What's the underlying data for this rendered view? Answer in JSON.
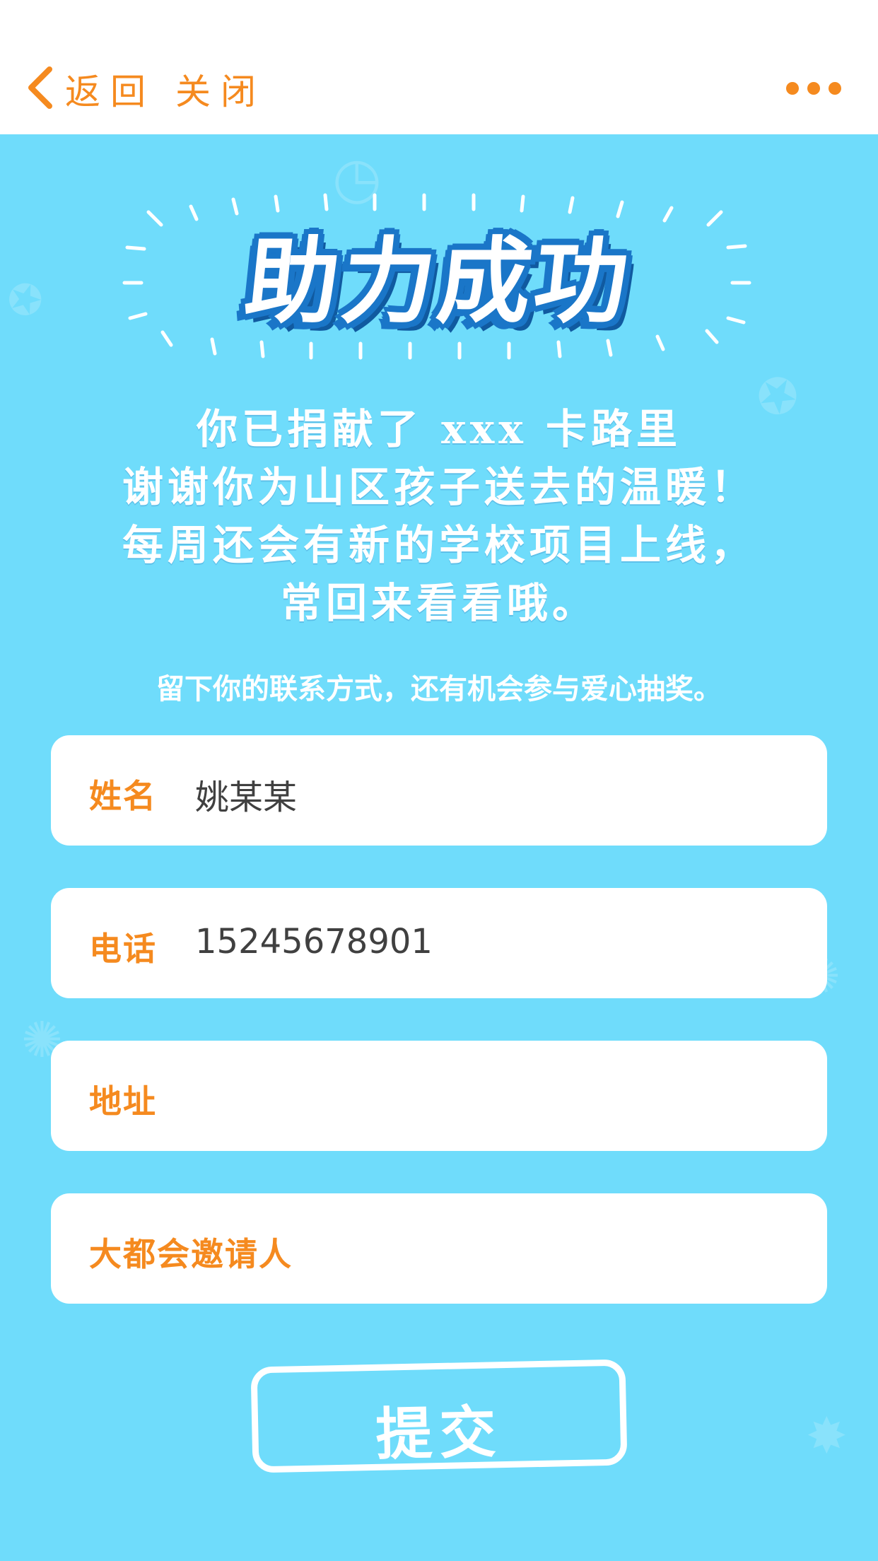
{
  "nav": {
    "back_label": "返回",
    "close_label": "关闭"
  },
  "hero": {
    "title": "助力成功"
  },
  "message": {
    "line1": "你已捐献了 xxx 卡路里",
    "line2": "谢谢你为山区孩子送去的温暖！",
    "line3": "每周还会有新的学校项目上线，",
    "line4": "常回来看看哦。"
  },
  "invite_text": "留下你的联系方式，还有机会参与爱心抽奖。",
  "form": {
    "fields": [
      {
        "label": "姓名",
        "value": "姚某某"
      },
      {
        "label": "电话",
        "value": "15245678901"
      },
      {
        "label": "地址",
        "value": ""
      },
      {
        "label": "大都会邀请人",
        "value": ""
      }
    ],
    "submit_label": "提交"
  },
  "colors": {
    "accent": "#f58a1f",
    "background": "#6fdcfb",
    "title_outline": "#1a76c8",
    "input_text": "#404040"
  }
}
